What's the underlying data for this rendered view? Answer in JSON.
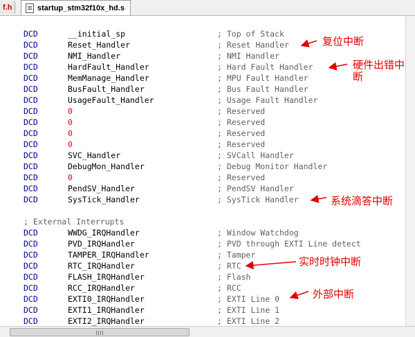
{
  "tabs": {
    "partial_label": "f.h",
    "active_label": "startup_stm32f10x_hd.s"
  },
  "lines": [
    {
      "kw": "DCD",
      "handler": "__initial_sp",
      "zero": "",
      "comment": "; Top of Stack"
    },
    {
      "kw": "DCD",
      "handler": "Reset_Handler",
      "zero": "",
      "comment": "; Reset Handler"
    },
    {
      "kw": "DCD",
      "handler": "NMI_Handler",
      "zero": "",
      "comment": "; NMI Handler"
    },
    {
      "kw": "DCD",
      "handler": "HardFault_Handler",
      "zero": "",
      "comment": "; Hard Fault Handler"
    },
    {
      "kw": "DCD",
      "handler": "MemManage_Handler",
      "zero": "",
      "comment": "; MPU Fault Handler"
    },
    {
      "kw": "DCD",
      "handler": "BusFault_Handler",
      "zero": "",
      "comment": "; Bus Fault Handler"
    },
    {
      "kw": "DCD",
      "handler": "UsageFault_Handler",
      "zero": "",
      "comment": "; Usage Fault Handler"
    },
    {
      "kw": "DCD",
      "handler": "",
      "zero": "0",
      "comment": "; Reserved"
    },
    {
      "kw": "DCD",
      "handler": "",
      "zero": "0",
      "comment": "; Reserved"
    },
    {
      "kw": "DCD",
      "handler": "",
      "zero": "0",
      "comment": "; Reserved"
    },
    {
      "kw": "DCD",
      "handler": "",
      "zero": "0",
      "comment": "; Reserved"
    },
    {
      "kw": "DCD",
      "handler": "SVC_Handler",
      "zero": "",
      "comment": "; SVCall Handler"
    },
    {
      "kw": "DCD",
      "handler": "DebugMon_Handler",
      "zero": "",
      "comment": "; Debug Monitor Handler"
    },
    {
      "kw": "DCD",
      "handler": "",
      "zero": "0",
      "comment": "; Reserved"
    },
    {
      "kw": "DCD",
      "handler": "PendSV_Handler",
      "zero": "",
      "comment": "; PendSV Handler"
    },
    {
      "kw": "DCD",
      "handler": "SysTick_Handler",
      "zero": "",
      "comment": "; SysTick Handler"
    }
  ],
  "section_comment": "; External Interrupts",
  "ext_lines": [
    {
      "kw": "DCD",
      "handler": "WWDG_IRQHandler",
      "comment": "; Window Watchdog"
    },
    {
      "kw": "DCD",
      "handler": "PVD_IRQHandler",
      "comment": "; PVD through EXTI Line detect"
    },
    {
      "kw": "DCD",
      "handler": "TAMPER_IRQHandler",
      "comment": "; Tamper"
    },
    {
      "kw": "DCD",
      "handler": "RTC_IRQHandler",
      "comment": "; RTC"
    },
    {
      "kw": "DCD",
      "handler": "FLASH_IRQHandler",
      "comment": "; Flash"
    },
    {
      "kw": "DCD",
      "handler": "RCC_IRQHandler",
      "comment": "; RCC"
    },
    {
      "kw": "DCD",
      "handler": "EXTI0_IRQHandler",
      "comment": "; EXTI Line 0"
    },
    {
      "kw": "DCD",
      "handler": "EXTI1_IRQHandler",
      "comment": "; EXTI Line 1"
    },
    {
      "kw": "DCD",
      "handler": "EXTI2_IRQHandler",
      "comment": "; EXTI Line 2"
    }
  ],
  "annotations": {
    "reset": "复位中断",
    "hardfault_1": "硬件出错中",
    "hardfault_2": "断",
    "systick": "系统滴答中断",
    "rtc": "实时时钟中断",
    "exti": "外部中断"
  },
  "colors": {
    "keyword": "#00008b",
    "zero": "#e00000",
    "comment": "#606060",
    "annotation": "#e00000"
  }
}
